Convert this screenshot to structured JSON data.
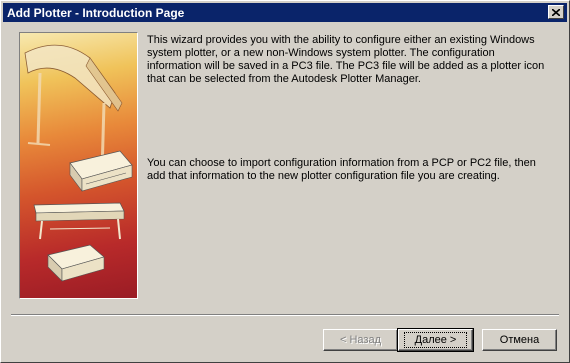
{
  "window": {
    "title": "Add Plotter - Introduction Page"
  },
  "content": {
    "paragraph1": "This wizard provides you with the ability to configure either an existing Windows system plotter, or a new non-Windows system plotter. The configuration information will be saved in a PC3 file. The PC3 file will be added as a plotter icon that can be selected from the Autodesk Plotter Manager.",
    "paragraph2": "You can choose to import configuration information from a PCP or PC2 file, then add that information to the new plotter configuration file you are creating."
  },
  "buttons": {
    "back": "< Назад",
    "next": "Далее >",
    "cancel": "Отмена"
  },
  "icons": {
    "close": "close-icon",
    "illustration": "plotter-illustration"
  },
  "colors": {
    "titlebar": "#0a246a",
    "face": "#d4d0c8"
  }
}
